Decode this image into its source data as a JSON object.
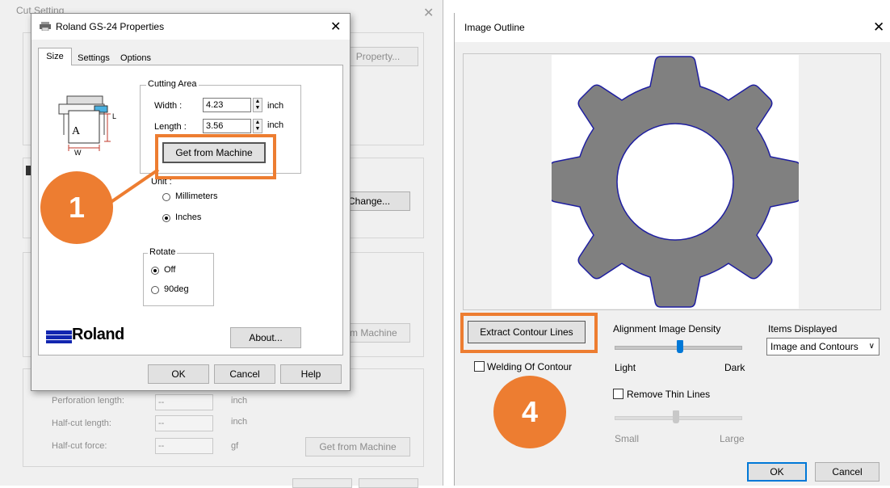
{
  "colors": {
    "accent_orange": "#ed7d31",
    "gear_fill": "#808080",
    "gear_outline": "#1e1ea0",
    "roland_blue": "#1226b0"
  },
  "bg_dialog": {
    "title": "Cut Setting",
    "property_button": "Property...",
    "change_button": "Change...",
    "get_from_machine_partial": "m Machine",
    "perforation_length_label": "Perforation length:",
    "perforation_length_value": "--",
    "perforation_length_unit": "inch",
    "half_cut_length_label": "Half-cut length:",
    "half_cut_length_value": "--",
    "half_cut_length_unit": "inch",
    "half_cut_force_label": "Half-cut force:",
    "half_cut_force_value": "--",
    "half_cut_force_unit": "gf",
    "get_from_machine_button": "Get from Machine"
  },
  "props_dialog": {
    "title": "Roland GS-24 Properties",
    "tabs": [
      "Size",
      "Settings",
      "Options"
    ],
    "cutting_area_label": "Cutting Area",
    "width_label": "Width :",
    "width_value": "4.23",
    "width_unit": "inch",
    "length_label": "Length :",
    "length_value": "3.56",
    "length_unit": "inch",
    "get_from_machine": "Get from Machine",
    "unit_label": "Unit :",
    "unit_millimeters": "Millimeters",
    "unit_inches": "Inches",
    "rotate_label": "Rotate",
    "rotate_off": "Off",
    "rotate_90": "90deg",
    "logo": "Roland",
    "about_button": "About...",
    "ok_button": "OK",
    "cancel_button": "Cancel",
    "help_button": "Help",
    "diagram_a": "A",
    "diagram_l": "L",
    "diagram_w": "W"
  },
  "outline_dialog": {
    "title": "Image Outline",
    "extract_button": "Extract Contour Lines",
    "welding_label": "Welding Of Contour",
    "density_label": "Alignment Image Density",
    "light_label": "Light",
    "dark_label": "Dark",
    "remove_thin_label": "Remove Thin Lines",
    "small_label": "Small",
    "large_label": "Large",
    "items_displayed_label": "Items Displayed",
    "items_displayed_value": "Image and Contours",
    "ok_button": "OK",
    "cancel_button": "Cancel"
  },
  "callouts": {
    "step1": "1",
    "step4": "4"
  }
}
